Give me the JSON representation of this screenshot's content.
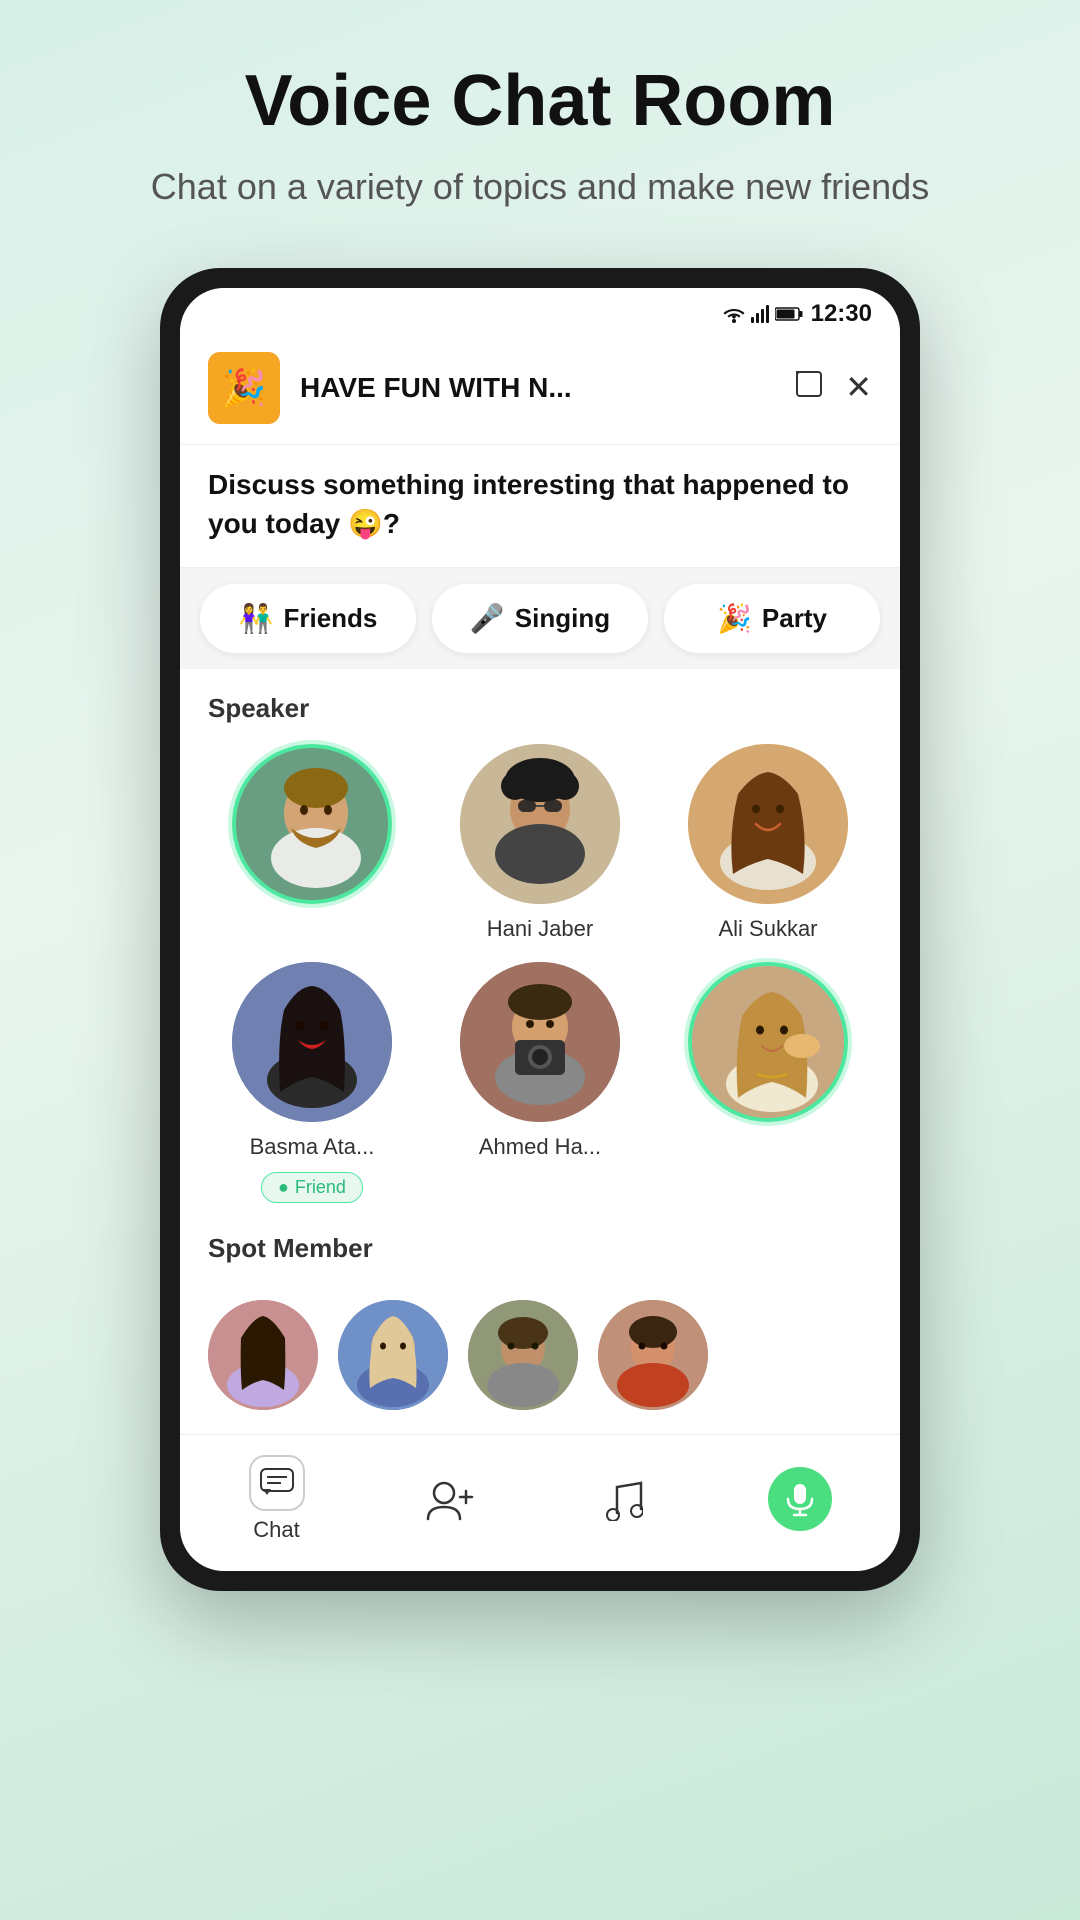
{
  "page": {
    "title": "Voice Chat Room",
    "subtitle": "Chat on a variety of topics and make new friends"
  },
  "status_bar": {
    "time": "12:30",
    "wifi": "▼",
    "signal": "▲",
    "battery": "🔋"
  },
  "chat_header": {
    "avatar_emoji": "🎉",
    "title": "HAVE FUN WITH N...",
    "expand_icon": "⊡",
    "close_icon": "✕"
  },
  "chat_description": "Discuss something interesting that happened to you today 😜?",
  "tabs": [
    {
      "id": "friends",
      "emoji": "👫",
      "label": "Friends"
    },
    {
      "id": "singing",
      "emoji": "🎤",
      "label": "Singing"
    },
    {
      "id": "party",
      "emoji": "🎉",
      "label": "Party"
    }
  ],
  "speaker_section": {
    "title": "Speaker",
    "speakers": [
      {
        "id": 1,
        "name": "",
        "has_ring": true,
        "avatar_class": "avatar-1"
      },
      {
        "id": 2,
        "name": "Hani Jaber",
        "has_ring": false,
        "avatar_class": "avatar-2"
      },
      {
        "id": 3,
        "name": "Ali Sukkar",
        "has_ring": false,
        "avatar_class": "avatar-3"
      },
      {
        "id": 4,
        "name": "Basma Ata...",
        "has_ring": false,
        "avatar_class": "avatar-4",
        "badge": "Friend"
      },
      {
        "id": 5,
        "name": "Ahmed Ha...",
        "has_ring": false,
        "avatar_class": "avatar-5"
      },
      {
        "id": 6,
        "name": "",
        "has_ring": true,
        "avatar_class": "avatar-6"
      }
    ]
  },
  "spot_section": {
    "title": "Spot Member",
    "members": [
      {
        "id": 1,
        "avatar_class": "avatar-sm-1"
      },
      {
        "id": 2,
        "avatar_class": "avatar-sm-2"
      },
      {
        "id": 3,
        "avatar_class": "avatar-sm-3"
      },
      {
        "id": 4,
        "avatar_class": "avatar-sm-4"
      }
    ]
  },
  "bottom_nav": [
    {
      "id": "chat",
      "icon": "💬",
      "label": "Chat",
      "type": "chat-nav"
    },
    {
      "id": "add-friend",
      "icon": "👤+",
      "label": "",
      "type": "icon-nav"
    },
    {
      "id": "music",
      "icon": "♪",
      "label": "",
      "type": "icon-nav"
    },
    {
      "id": "mic",
      "icon": "🎤",
      "label": "",
      "type": "mic-nav"
    }
  ]
}
